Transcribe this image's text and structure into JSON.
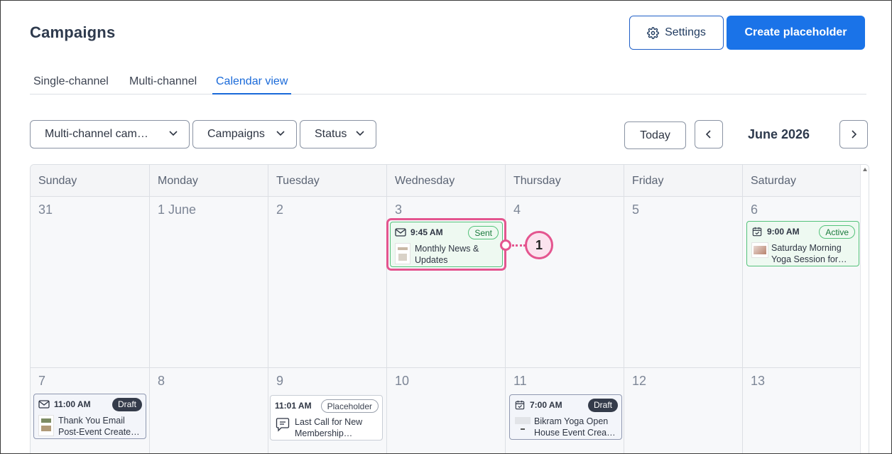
{
  "header": {
    "title": "Campaigns",
    "settings_label": "Settings",
    "create_label": "Create placeholder"
  },
  "tabs": [
    {
      "label": "Single-channel",
      "active": false
    },
    {
      "label": "Multi-channel",
      "active": false
    },
    {
      "label": "Calendar view",
      "active": true
    }
  ],
  "filters": {
    "channel": "Multi-channel cam…",
    "type": "Campaigns",
    "status": "Status"
  },
  "nav": {
    "today_label": "Today",
    "month": "June 2026"
  },
  "weekdays": [
    "Sunday",
    "Monday",
    "Tuesday",
    "Wednesday",
    "Thursday",
    "Friday",
    "Saturday"
  ],
  "weeks": [
    [
      "31",
      "1 June",
      "2",
      "3",
      "4",
      "5",
      "6"
    ],
    [
      "7",
      "8",
      "9",
      "10",
      "11",
      "12",
      "13"
    ]
  ],
  "events": {
    "e1": {
      "time": "9:45 AM",
      "badge": "Sent",
      "line1": "Monthly News &",
      "line2": "Updates",
      "icon": "envelope-icon"
    },
    "e2": {
      "time": "9:00 AM",
      "badge": "Active",
      "line1": "Saturday Morning",
      "line2": "Yoga Session for…",
      "icon": "calendar-check-icon"
    },
    "e3": {
      "time": "11:00 AM",
      "badge": "Draft",
      "line1": "Thank You Email",
      "line2": "Post-Event Created…",
      "icon": "envelope-icon"
    },
    "e4": {
      "time": "11:01 AM",
      "badge": "Placeholder",
      "line1": "Last Call for New",
      "line2": "Membership…",
      "icon": "message-icon"
    },
    "e5": {
      "time": "7:00 AM",
      "badge": "Draft",
      "line1": "Bikram Yoga Open",
      "line2": "House Event Creat…",
      "icon": "calendar-check-icon"
    }
  },
  "callout": {
    "number": "1"
  },
  "colors": {
    "accent": "#1a73e8",
    "sent_green": "#54c27a",
    "draft_dark": "#343b4a",
    "callout_pink": "#e4558f"
  }
}
